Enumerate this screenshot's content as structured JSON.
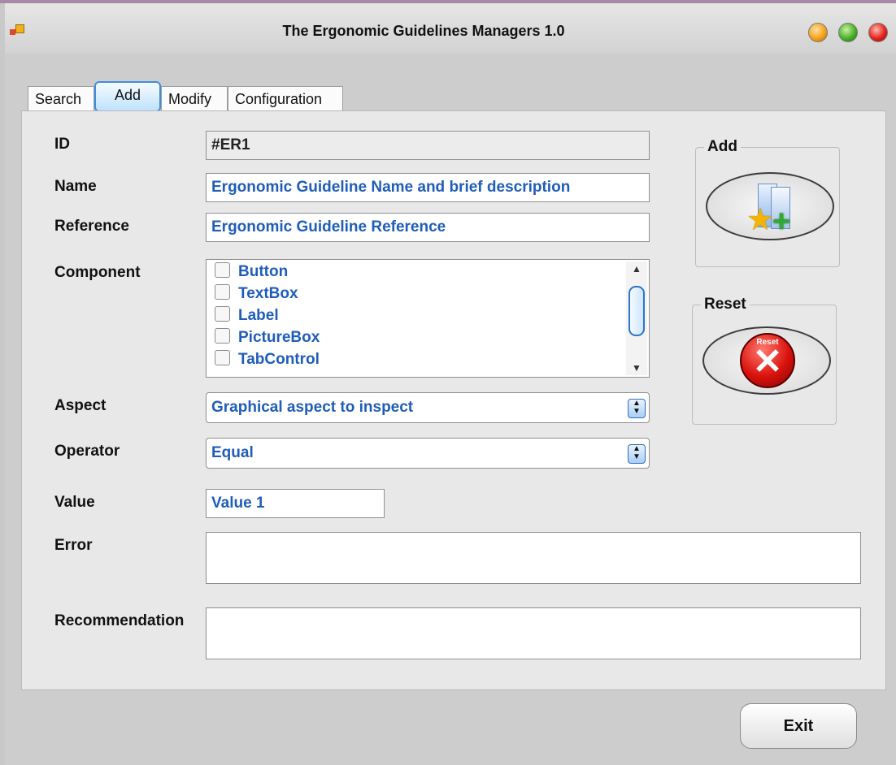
{
  "window": {
    "title": "The Ergonomic Guidelines Managers 1.0",
    "icon": "app-window-icon",
    "controls": [
      "minimize-orb",
      "maximize-orb",
      "close-orb"
    ]
  },
  "tabs": [
    {
      "label": "Search",
      "active": false
    },
    {
      "label": "Add",
      "active": true
    },
    {
      "label": "Modify",
      "active": false
    },
    {
      "label": "Configuration",
      "active": false
    }
  ],
  "form": {
    "id": {
      "label": "ID",
      "value": "#ER1"
    },
    "name": {
      "label": "Name",
      "value": "Ergonomic Guideline Name and brief description"
    },
    "reference": {
      "label": "Reference",
      "value": "Ergonomic Guideline Reference"
    },
    "component": {
      "label": "Component",
      "items": [
        "Button",
        "TextBox",
        "Label",
        "PictureBox",
        "TabControl"
      ]
    },
    "aspect": {
      "label": "Aspect",
      "value": "Graphical aspect to inspect"
    },
    "operator": {
      "label": "Operator",
      "value": "Equal"
    },
    "value": {
      "label": "Value",
      "value": "Value 1"
    },
    "error": {
      "label": "Error",
      "value": ""
    },
    "recommendation": {
      "label": "Recommendation",
      "value": ""
    }
  },
  "actions": {
    "add": {
      "legend": "Add",
      "icon": "add-star-plus-icon"
    },
    "reset": {
      "legend": "Reset",
      "icon": "reset-x-icon",
      "icon_caption": "Reset"
    }
  },
  "footer": {
    "exit_label": "Exit"
  },
  "colors": {
    "field_text": "#1f5db8",
    "active_tab_border": "#3d8ee0"
  }
}
